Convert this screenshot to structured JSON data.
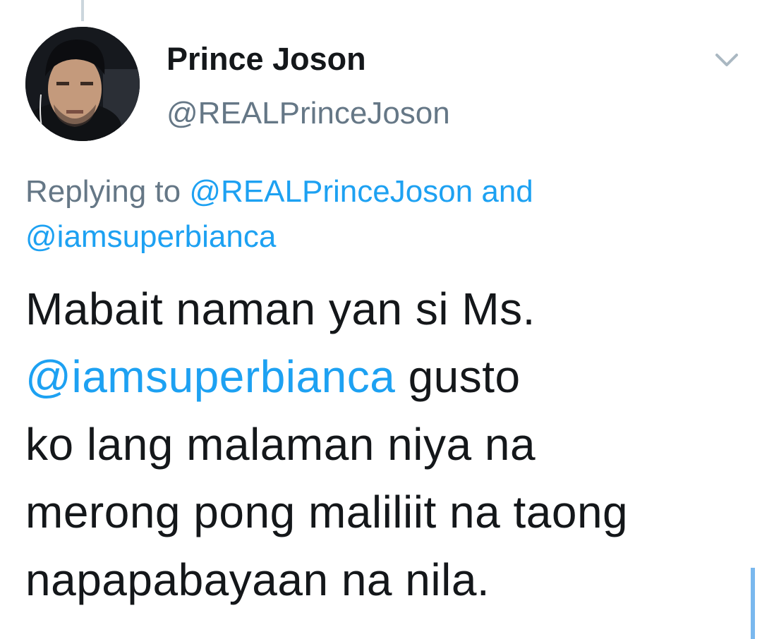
{
  "author": {
    "display_name": "Prince Joson",
    "handle": "@REALPrinceJoson"
  },
  "reply_context": {
    "prefix": "Replying to",
    "mention_1": "@REALPrinceJoson",
    "mention_2": "and @iamsuperbianca"
  },
  "tweet": {
    "line_1": "Mabait naman yan si Ms.",
    "line_2_mention": "@iamsuperbianca",
    "line_2_rest": " gusto",
    "line_3": "ko lang malaman niya na",
    "line_4": "merong pong maliliit na taong",
    "line_5": "napapabayaan na nila."
  },
  "icons": {
    "menu": "chevron-down-icon",
    "avatar": "profile-photo"
  },
  "colors": {
    "link": "#1da1f2",
    "secondary_text": "#657786",
    "primary_text": "#14171a",
    "thread_line": "#ccd6dd"
  }
}
